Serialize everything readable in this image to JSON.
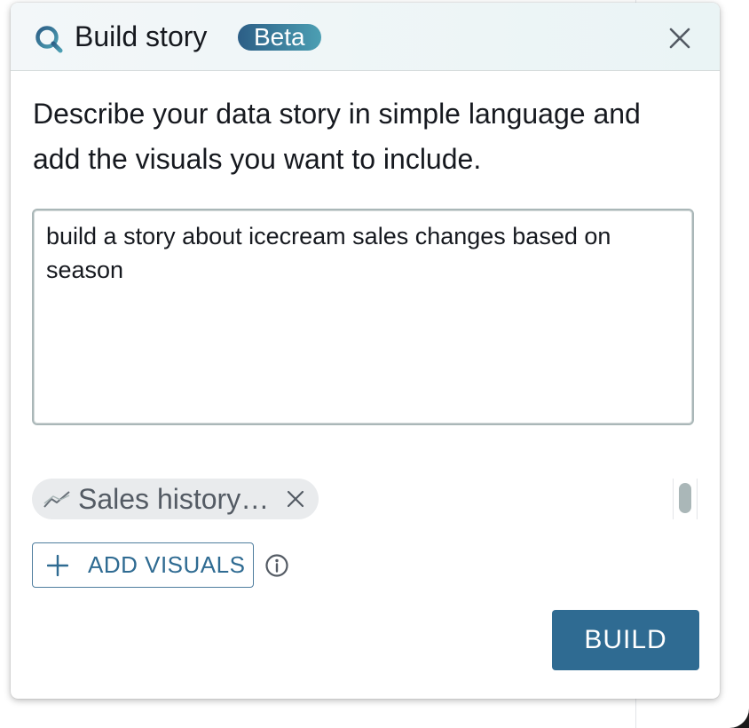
{
  "header": {
    "title": "Build story",
    "badge": "Beta",
    "icon": "search-icon",
    "close_icon": "close-icon"
  },
  "description": "Describe your data story in simple language and add the visuals you want to include.",
  "prompt": {
    "value": "build a story about icecream sales changes based on season"
  },
  "visuals": {
    "chips": [
      {
        "label": "Sales history…",
        "icon": "line-chart-icon",
        "remove_icon": "close-icon"
      }
    ]
  },
  "add_visuals": {
    "label": "ADD VISUALS",
    "icon": "plus-icon",
    "info_icon": "info-icon"
  },
  "build": {
    "label": "BUILD"
  },
  "colors": {
    "primary": "#2f6b92",
    "badge_start": "#2c5e86",
    "badge_end": "#4c9fb3",
    "text": "#16191f",
    "chip_bg": "#e9ebed"
  }
}
